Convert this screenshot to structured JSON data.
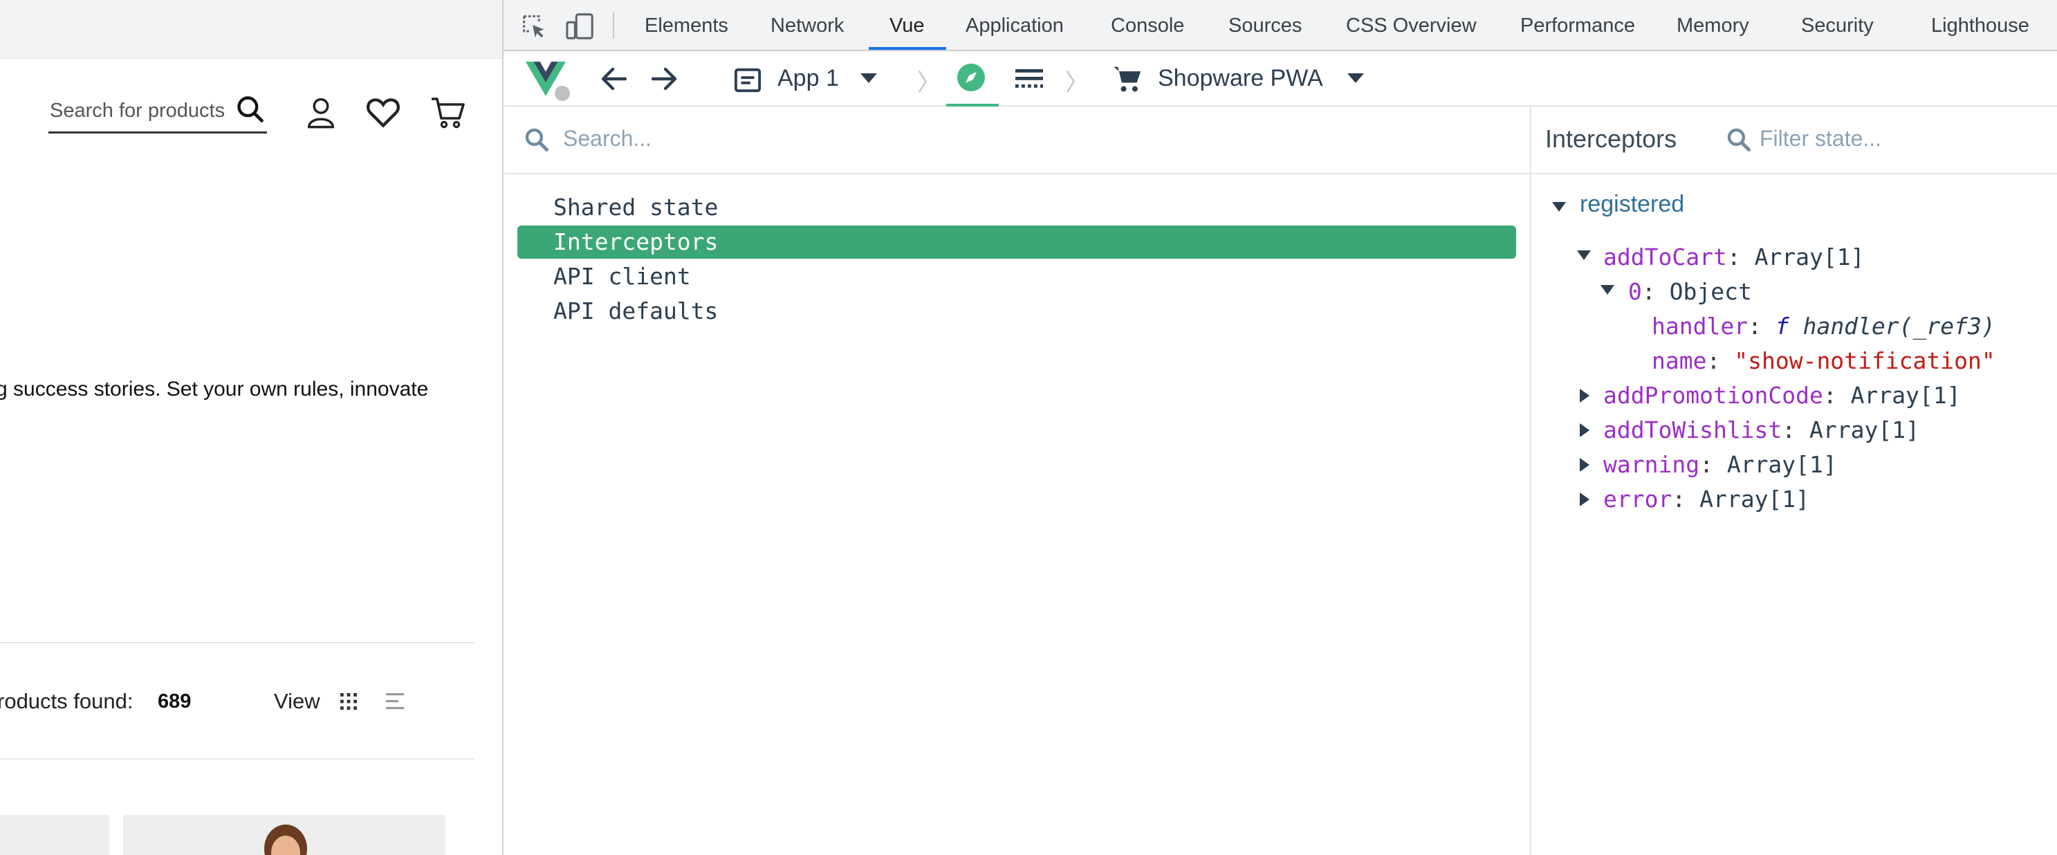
{
  "shop": {
    "search_placeholder": "Search for products",
    "hero_text": "g success stories. Set your own rules, innovate",
    "products_found_label": "roducts found:",
    "products_found_count": "689",
    "view_label": "View"
  },
  "devtools": {
    "tabs": [
      "Elements",
      "Network",
      "Vue",
      "Application",
      "Console",
      "Sources",
      "CSS Overview",
      "Performance",
      "Memory",
      "Security",
      "Lighthouse"
    ],
    "active_tab": "Vue",
    "accent_color": "#1a73e8"
  },
  "vue_toolbar": {
    "app_selector": "App 1",
    "store_selector": "Shopware PWA",
    "vue_green": "#42b883"
  },
  "inspector": {
    "search_placeholder": "Search...",
    "items": [
      "Shared state",
      "Interceptors",
      "API client",
      "API defaults"
    ],
    "selected_item": "Interceptors",
    "selected_color": "#3ba776"
  },
  "state": {
    "title": "Interceptors",
    "filter_placeholder": "Filter state...",
    "section": "registered",
    "entries": {
      "addToCart": {
        "key": "addToCart",
        "value": "Array[1]"
      },
      "item0": {
        "key": "0",
        "value": "Object"
      },
      "handler": {
        "key": "handler",
        "fn": "f",
        "fn_name": "handler(_ref3)"
      },
      "name": {
        "key": "name",
        "value": "\"show-notification\""
      },
      "addPromotionCode": {
        "key": "addPromotionCode",
        "value": "Array[1]"
      },
      "addToWishlist": {
        "key": "addToWishlist",
        "value": "Array[1]"
      },
      "warning": {
        "key": "warning",
        "value": "Array[1]"
      },
      "error": {
        "key": "error",
        "value": "Array[1]"
      }
    }
  }
}
